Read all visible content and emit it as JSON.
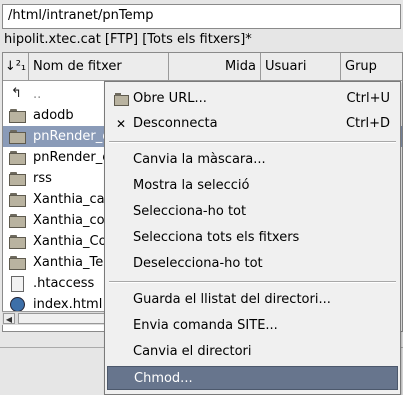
{
  "path": {
    "value": "/html/intranet/pnTemp"
  },
  "site_label": "hipolit.xtec.cat [FTP] [Tots els fitxers]*",
  "columns": {
    "sort_icon": "↓²₁",
    "name": "Nom de fitxer",
    "size": "Mida",
    "user": "Usuari",
    "group": "Grup"
  },
  "files": [
    {
      "name": "..",
      "icon": "up-arrow-icon"
    },
    {
      "name": "adodb",
      "icon": "folder-icon"
    },
    {
      "name": "pnRender_c",
      "icon": "folder-icon",
      "selected": true
    },
    {
      "name": "pnRender_c",
      "icon": "folder-icon"
    },
    {
      "name": "rss",
      "icon": "folder-icon"
    },
    {
      "name": "Xanthia_ca",
      "icon": "folder-icon"
    },
    {
      "name": "Xanthia_co",
      "icon": "folder-icon"
    },
    {
      "name": "Xanthia_Co",
      "icon": "folder-icon"
    },
    {
      "name": "Xanthia_Te",
      "icon": "folder-icon"
    },
    {
      "name": ".htaccess",
      "icon": "document-icon"
    },
    {
      "name": "index.html",
      "icon": "globe-icon"
    }
  ],
  "context_menu": {
    "open_url": {
      "label": "Obre URL...",
      "shortcut": "Ctrl+U",
      "icon": "folder-icon"
    },
    "disconnect": {
      "label": "Desconnecta",
      "shortcut": "Ctrl+D",
      "icon": "close-x-icon"
    },
    "change_mask": {
      "label": "Canvia la màscara..."
    },
    "show_selection": {
      "label": "Mostra la selecció"
    },
    "select_all": {
      "label": "Selecciona-ho tot"
    },
    "select_all_files": {
      "label": "Selecciona tots els fitxers"
    },
    "deselect_all": {
      "label": "Deselecciona-ho tot"
    },
    "save_listing": {
      "label": "Guarda el llistat del directori..."
    },
    "send_site": {
      "label": "Envia comanda SITE..."
    },
    "change_dir": {
      "label": "Canvia el directori"
    },
    "chmod": {
      "label": "Chmod..."
    }
  },
  "colors": {
    "selection": "#8a9bb8",
    "menu_highlight": "#67758d"
  }
}
